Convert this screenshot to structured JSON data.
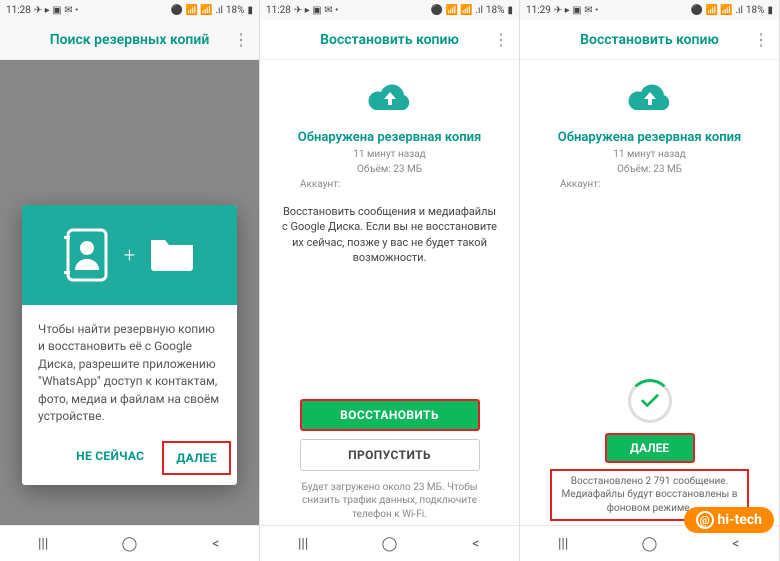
{
  "screen1": {
    "status_time": "11:28",
    "status_battery": "18%",
    "app_title": "Поиск резервных копий",
    "dialog_text": "Чтобы найти резервную копию и восстановить её с Google Диска, разрешите приложению \"WhatsApp\" доступ к контактам, фото, медиа и файлам на своём устройстве.",
    "btn_not_now": "НЕ СЕЙЧАС",
    "btn_next": "ДАЛЕЕ"
  },
  "screen2": {
    "status_time": "11:28",
    "status_battery": "18%",
    "app_title": "Восстановить копию",
    "section_title": "Обнаружена резервная копия",
    "meta_age": "11 минут назад",
    "meta_size": "Объём: 23 МБ",
    "meta_account": "Аккаунт:",
    "desc": "Восстановить сообщения и медиафайлы с Google Диска. Если вы не восстановите их сейчас, позже у вас не будет такой возможности.",
    "btn_restore": "ВОССТАНОВИТЬ",
    "btn_skip": "ПРОПУСТИТЬ",
    "footnote": "Будет загружено около 23 МБ. Чтобы снизить трафик данных, подключите телефон к Wi-Fi."
  },
  "screen3": {
    "status_time": "11:29",
    "status_battery": "18%",
    "app_title": "Восстановить копию",
    "section_title": "Обнаружена резервная копия",
    "meta_age": "11 минут назад",
    "meta_size": "Объём: 23 МБ",
    "meta_account": "Аккаунт:",
    "btn_next": "ДАЛЕЕ",
    "footnote": "Восстановлено 2 791 сообщение. Медиафайлы будут восстановлены в фоновом режиме."
  },
  "watermark": "hi-tech",
  "icons": {
    "status_glyphs": "◢ ◢ ▮◢ ▮▮▮▮ ☼ ",
    "signal_glyphs": "📶 .ıll"
  }
}
